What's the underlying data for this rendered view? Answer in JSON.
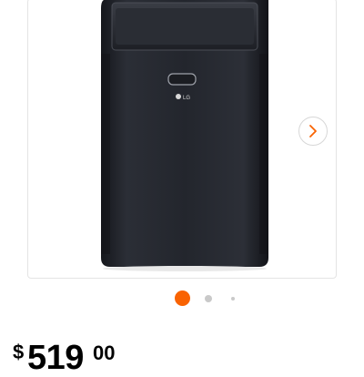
{
  "product": {
    "brand_logo": "LG",
    "image_icon": "portable-air-conditioner"
  },
  "carousel": {
    "next_icon": "chevron-right-icon",
    "accent_color": "#f96302",
    "dots_total": 3,
    "active_index": 0
  },
  "price": {
    "currency": "$",
    "dollars": "519",
    "cents": "00"
  }
}
